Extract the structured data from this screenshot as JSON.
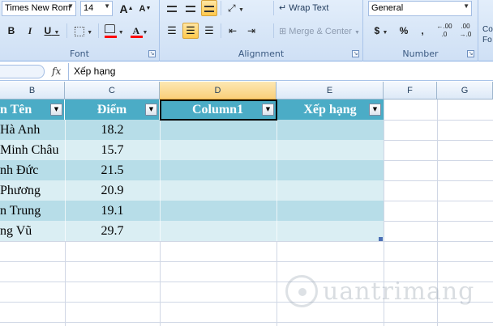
{
  "ribbon": {
    "font_group": {
      "label": "Font",
      "font_name": "Times New Rom",
      "font_size": "14",
      "grow_font": "A",
      "shrink_font": "A",
      "bold": "B",
      "italic": "I",
      "underline": "U",
      "fill_color": "#ff0000",
      "font_color": "#ff0000"
    },
    "alignment_group": {
      "label": "Alignment",
      "wrap_text": "Wrap Text",
      "merge_center": "Merge & Center"
    },
    "number_group": {
      "label": "Number",
      "format": "General",
      "currency": "$",
      "percent": "%",
      "comma": ",",
      "increase_decimal": ".00",
      "decrease_decimal": ".00"
    },
    "styles_group": {
      "partial_label_1": "Co",
      "partial_label_2": "Fo"
    }
  },
  "formula_bar": {
    "fx": "fx",
    "value": "Xếp hạng"
  },
  "columns": [
    "B",
    "C",
    "D",
    "E",
    "F",
    "G"
  ],
  "table": {
    "headers": [
      "n Tên",
      "Điểm",
      "Column1",
      "Xếp hạng"
    ],
    "rows": [
      {
        "name": "Hà Anh",
        "score": "18.2"
      },
      {
        "name": "Minh Châu",
        "score": "15.7"
      },
      {
        "name": "nh Đức",
        "score": "21.5"
      },
      {
        "name": "Phương",
        "score": "20.9"
      },
      {
        "name": "n Trung",
        "score": "19.1"
      },
      {
        "name": "ng Vũ",
        "score": "29.7"
      }
    ]
  },
  "watermark": {
    "text": "uantrimang"
  }
}
